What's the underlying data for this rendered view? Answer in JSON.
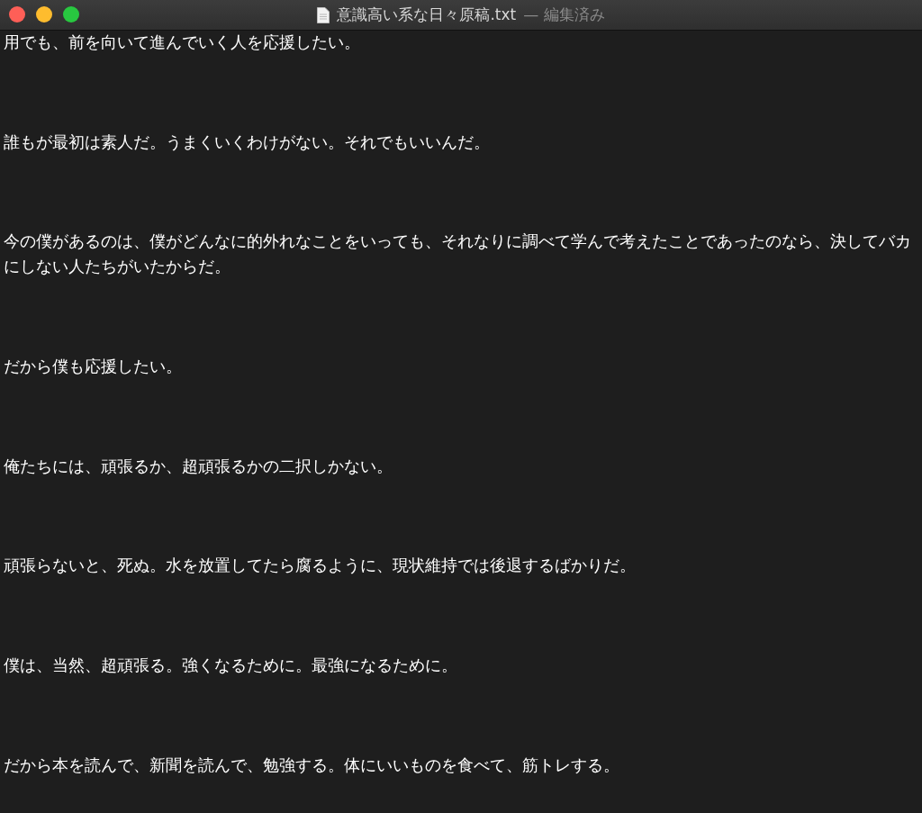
{
  "window": {
    "title": "意識高い系な日々原稿.txt",
    "status": "— 編集済み"
  },
  "paragraphs": [
    "用でも、前を向いて進んでいく人を応援したい。",
    "誰もが最初は素人だ。うまくいくわけがない。それでもいいんだ。",
    "今の僕があるのは、僕がどんなに的外れなことをいっても、それなりに調べて学んで考えたことであったのなら、決してバカにしない人たちがいたからだ。",
    "だから僕も応援したい。",
    "俺たちには、頑張るか、超頑張るかの二択しかない。",
    "頑張らないと、死ぬ。水を放置してたら腐るように、現状維持では後退するばかりだ。",
    "僕は、当然、超頑張る。強くなるために。最強になるために。",
    "だから本を読んで、新聞を読んで、勉強する。体にいいものを食べて、筋トレする。"
  ]
}
